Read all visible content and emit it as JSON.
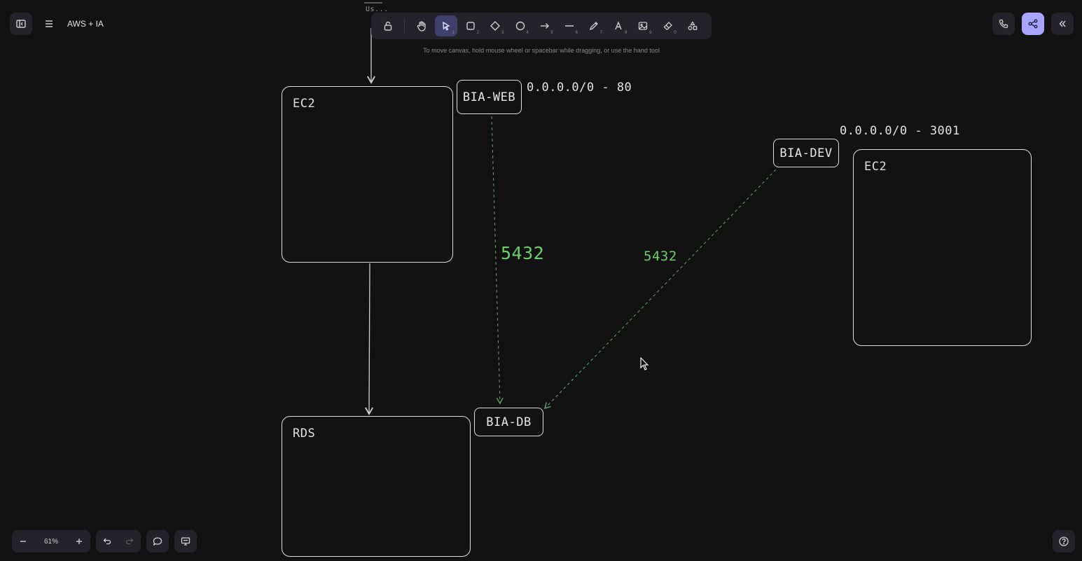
{
  "app": {
    "document_title": "AWS + IA",
    "hint": "To move canvas, hold mouse wheel or spacebar while dragging, or use the hand tool",
    "accent_color": "#a8a5ff",
    "stroke_color": "#dedede",
    "port_label_color": "#6ccf6c"
  },
  "toolbar": {
    "tools": [
      {
        "name": "lock-icon",
        "key": ""
      },
      {
        "name": "hand-icon",
        "key": ""
      },
      {
        "name": "pointer-icon",
        "key": "1",
        "active": true
      },
      {
        "name": "rectangle-icon",
        "key": "2"
      },
      {
        "name": "diamond-icon",
        "key": "3"
      },
      {
        "name": "ellipse-icon",
        "key": "4"
      },
      {
        "name": "arrow-icon",
        "key": "5"
      },
      {
        "name": "line-icon",
        "key": "6"
      },
      {
        "name": "pencil-icon",
        "key": "7"
      },
      {
        "name": "text-icon",
        "key": "8"
      },
      {
        "name": "image-icon",
        "key": "9"
      },
      {
        "name": "eraser-icon",
        "key": "0"
      },
      {
        "name": "shapes-library-icon",
        "key": ""
      }
    ]
  },
  "footer": {
    "zoom": "61%"
  },
  "diagram": {
    "top_stub_text": "Us...",
    "ec2_left": "EC2",
    "ec2_right": "EC2",
    "rds": "RDS",
    "sg_web": "BIA-WEB",
    "sg_dev": "BIA-DEV",
    "sg_db": "BIA-DB",
    "rule_web": "0.0.0.0/0 - 80",
    "rule_dev": "0.0.0.0/0 - 3001",
    "port_web_db": "5432",
    "port_dev_db": "5432"
  }
}
